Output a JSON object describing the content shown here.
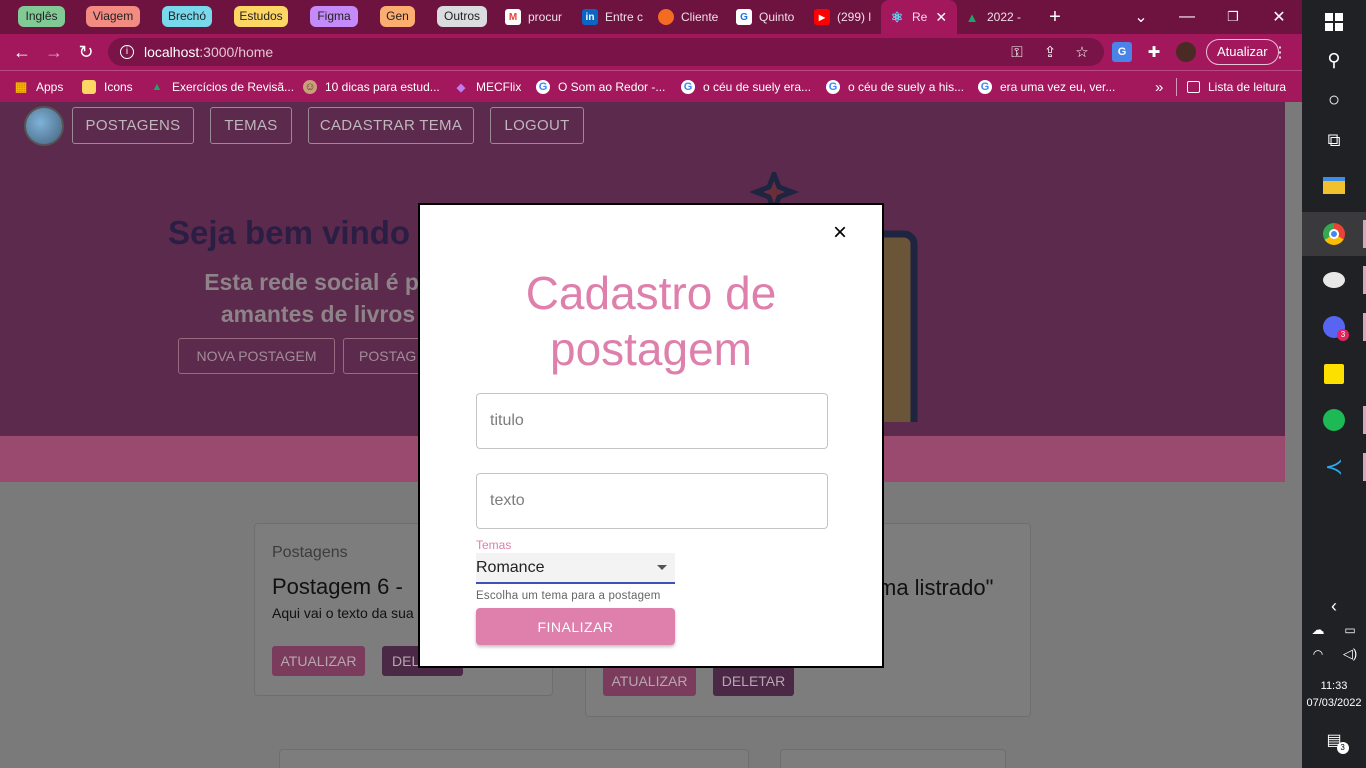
{
  "browser": {
    "tab_groups": [
      {
        "label": "Inglês",
        "color": "#81c995"
      },
      {
        "label": "Viagem",
        "color": "#f28b82"
      },
      {
        "label": "Brechó",
        "color": "#78d9ec"
      },
      {
        "label": "Estudos",
        "color": "#fdd663"
      },
      {
        "label": "Figma",
        "color": "#c58af9"
      },
      {
        "label": "Gen",
        "color": "#fcad70"
      },
      {
        "label": "Outros",
        "color": "#dadce0"
      }
    ],
    "tabs": [
      {
        "label": "procur",
        "icon": "gmail-icon",
        "glyph": "M",
        "color": "#ea4335"
      },
      {
        "label": "Entre c",
        "icon": "linkedin-icon",
        "glyph": "in",
        "color": "#0a66c2"
      },
      {
        "label": "Cliente",
        "icon": "orange-circle-icon",
        "glyph": "●",
        "color": "#f36c21"
      },
      {
        "label": "Quinto",
        "icon": "g-icon",
        "glyph": "G",
        "color": "#1a73e8"
      },
      {
        "label": "(299) l",
        "icon": "youtube-icon",
        "glyph": "▶",
        "color": "#ff0000"
      },
      {
        "label": "Re",
        "icon": "react-icon",
        "glyph": "⚛",
        "color": "#61dafb",
        "active": true
      },
      {
        "label": "2022 -",
        "icon": "drive-icon",
        "glyph": "▲",
        "color": "#1fa463"
      }
    ],
    "new_tab": "+",
    "address": {
      "host": "localhost",
      "path": ":3000/home"
    },
    "update_label": "Atualizar",
    "bookmarks": [
      {
        "label": "Apps",
        "icon": "apps-grid-icon",
        "glyph": "▦",
        "color": "#f4b400"
      },
      {
        "label": "Icons",
        "icon": "folder-icon",
        "glyph": "■",
        "color": "#fdd663"
      },
      {
        "label": "Exercícios de Revisã...",
        "icon": "drive-icon",
        "glyph": "▲",
        "color": "#1fa463"
      },
      {
        "label": "10 dicas para estud...",
        "icon": "profile-icon",
        "glyph": "☺",
        "color": "#c9a07a"
      },
      {
        "label": "MECFlix",
        "icon": "mecflix-icon",
        "glyph": "◆",
        "color": "#9b59b6"
      },
      {
        "label": "O Som ao Redor -...",
        "icon": "google-icon",
        "glyph": "G",
        "color": "#ffffff"
      },
      {
        "label": "o céu de suely era...",
        "icon": "google-icon",
        "glyph": "G",
        "color": "#ffffff"
      },
      {
        "label": "o céu de suely a his...",
        "icon": "google-icon",
        "glyph": "G",
        "color": "#ffffff"
      },
      {
        "label": "era uma vez eu, ver...",
        "icon": "google-icon",
        "glyph": "G",
        "color": "#ffffff"
      }
    ],
    "more_bookmarks": "»",
    "reading_list": "Lista de leitura"
  },
  "navbar": {
    "links": [
      "POSTAGENS",
      "TEMAS",
      "CADASTRAR TEMA",
      "LOGOUT"
    ]
  },
  "hero": {
    "title": "Seja bem vindo",
    "subtitle": "Esta rede social é pa amantes de livros",
    "buttons": [
      "NOVA POSTAGEM",
      "POSTAG"
    ]
  },
  "posts": [
    {
      "label": "Postagens",
      "title": "Postagem 6 -",
      "text": "Aqui vai o texto da sua",
      "update_label": "ATUALIZAR",
      "delete_label": "DEL"
    },
    {
      "title": "ma listrado\"",
      "update_label": "ATUALIZAR",
      "delete_label": "DELETAR"
    }
  ],
  "modal": {
    "close": "×",
    "title": "Cadastro de postagem",
    "title_placeholder": "titulo",
    "text_placeholder": "texto",
    "themes_label": "Temas",
    "themes_selected": "Romance",
    "themes_helper": "Escolha um tema para a postagem",
    "submit_label": "FINALIZAR"
  },
  "taskbar": {
    "apps": [
      {
        "name": "windows-start-icon"
      },
      {
        "name": "search-icon"
      },
      {
        "name": "cortana-icon"
      },
      {
        "name": "task-view-icon"
      },
      {
        "name": "file-explorer-icon"
      },
      {
        "name": "chrome-icon",
        "active": true
      },
      {
        "name": "paint-icon",
        "active": true
      },
      {
        "name": "discord-icon",
        "badge": "3",
        "active": true
      },
      {
        "name": "sticky-notes-icon"
      },
      {
        "name": "spotify-icon",
        "active": true
      },
      {
        "name": "vscode-icon",
        "active": true
      }
    ],
    "time": "11:33",
    "date": "07/03/2022",
    "notifications": "3"
  }
}
